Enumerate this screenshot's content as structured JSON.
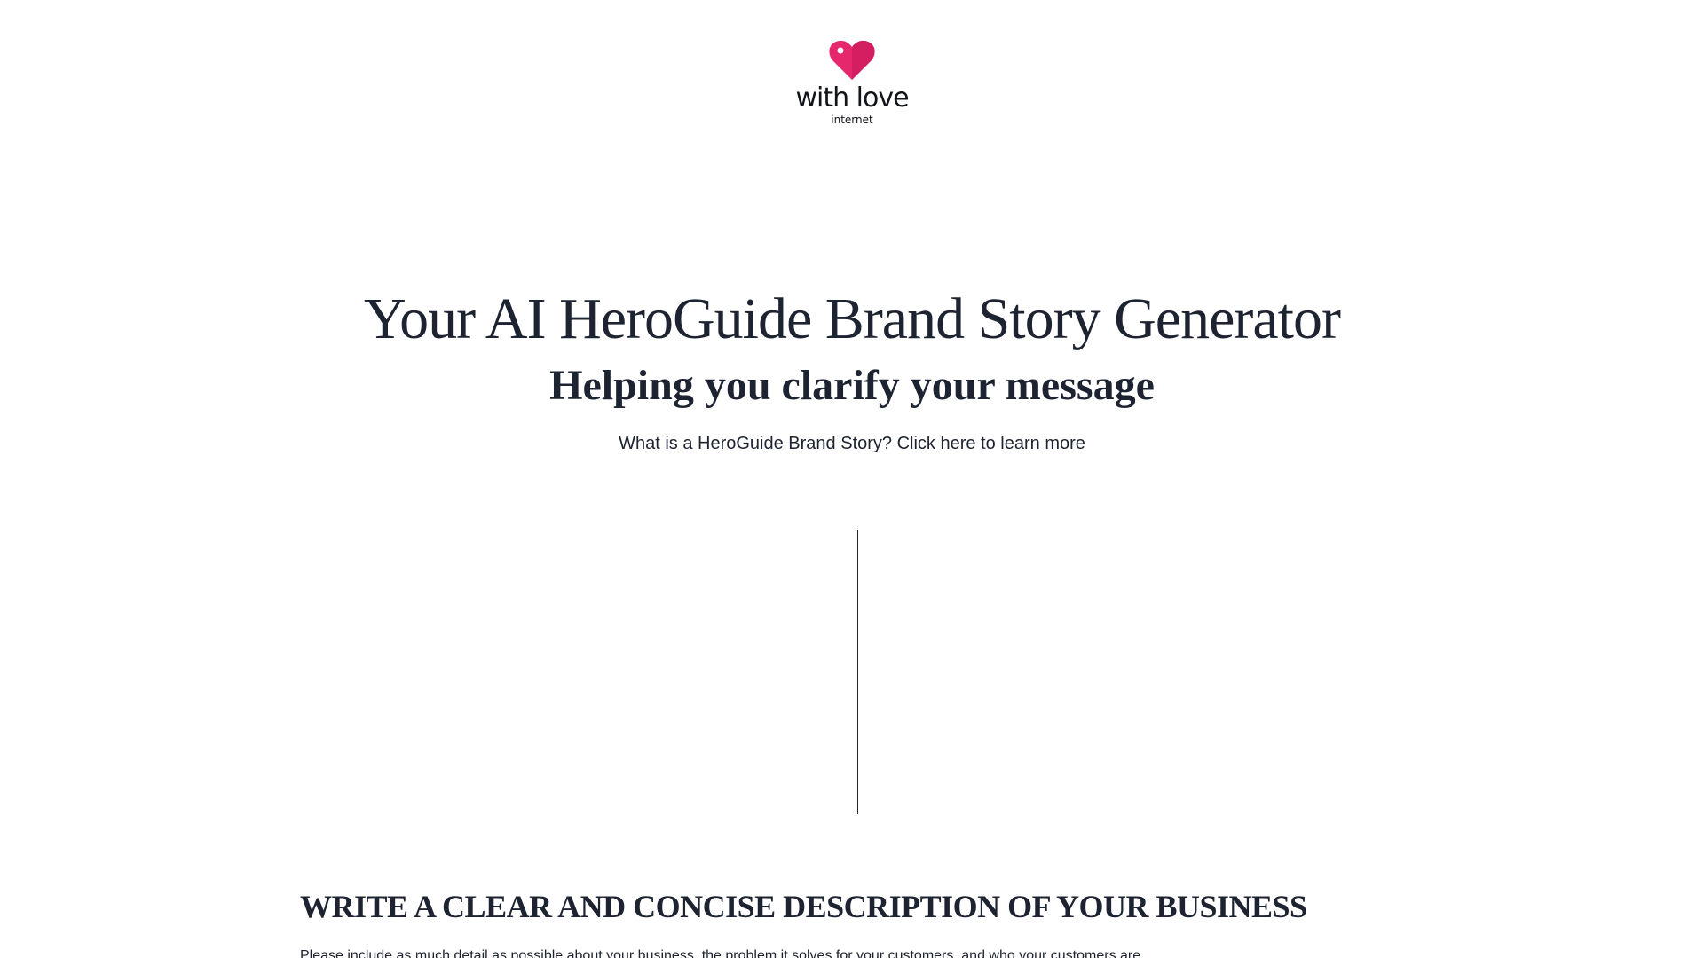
{
  "logo": {
    "wordmark": "with love",
    "sub": "internet",
    "icon": "heart-icon",
    "colors": {
      "heart_primary": "#e7276c",
      "heart_secondary": "#c2185b"
    }
  },
  "hero": {
    "title": "Your AI HeroGuide Brand Story Generator",
    "subtitle": "Helping you clarify your message",
    "learn_more_link": "What is a HeroGuide Brand Story? Click here to learn more"
  },
  "description_section": {
    "heading": "WRITE A CLEAR AND CONCISE DESCRIPTION OF YOUR BUSINESS",
    "helper_text": "Please include as much detail as possible about your business, the problem it solves for your customers, and who your customers are."
  },
  "colors": {
    "text": "#1d2330",
    "background": "#ffffff"
  }
}
